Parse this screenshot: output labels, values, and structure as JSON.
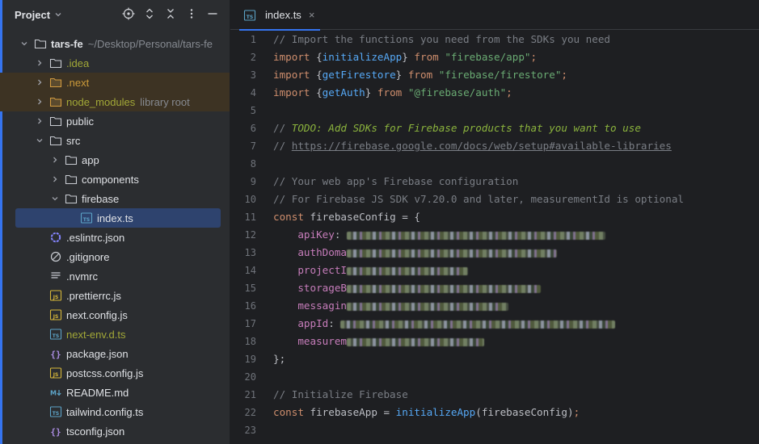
{
  "panel": {
    "title": "Project",
    "icons": [
      "locate-icon",
      "expand-collapse-icon",
      "collapse-all-icon",
      "more-options-icon",
      "minimize-icon"
    ]
  },
  "tree": [
    {
      "label": "tars-fe",
      "hint": "~/Desktop/Personal/tars-fe",
      "depth": 0,
      "chev": "down",
      "icon": "folder",
      "style": "bold"
    },
    {
      "label": ".idea",
      "depth": 1,
      "chev": "right",
      "icon": "folder",
      "style": "modified"
    },
    {
      "label": ".next",
      "depth": 1,
      "chev": "right",
      "icon": "folder-excluded",
      "style": "excluded",
      "ignored": true
    },
    {
      "label": "node_modules",
      "hint": "library root",
      "depth": 1,
      "chev": "right",
      "icon": "folder-excluded",
      "style": "modified",
      "ignored": true
    },
    {
      "label": "public",
      "depth": 1,
      "chev": "right",
      "icon": "folder",
      "style": ""
    },
    {
      "label": "src",
      "depth": 1,
      "chev": "down",
      "icon": "folder",
      "style": ""
    },
    {
      "label": "app",
      "depth": 2,
      "chev": "right",
      "icon": "folder",
      "style": ""
    },
    {
      "label": "components",
      "depth": 2,
      "chev": "right",
      "icon": "folder",
      "style": ""
    },
    {
      "label": "firebase",
      "depth": 2,
      "chev": "down",
      "icon": "folder",
      "style": ""
    },
    {
      "label": "index.ts",
      "depth": 3,
      "chev": "none",
      "icon": "ts",
      "style": "",
      "selected": true
    },
    {
      "label": ".eslintrc.json",
      "depth": 1,
      "chev": "none",
      "icon": "eslint",
      "style": ""
    },
    {
      "label": ".gitignore",
      "depth": 1,
      "chev": "none",
      "icon": "ignore",
      "style": ""
    },
    {
      "label": ".nvmrc",
      "depth": 1,
      "chev": "none",
      "icon": "text",
      "style": ""
    },
    {
      "label": ".prettierrc.js",
      "depth": 1,
      "chev": "none",
      "icon": "js",
      "style": ""
    },
    {
      "label": "next.config.js",
      "depth": 1,
      "chev": "none",
      "icon": "js",
      "style": ""
    },
    {
      "label": "next-env.d.ts",
      "depth": 1,
      "chev": "none",
      "icon": "ts",
      "style": "modified"
    },
    {
      "label": "package.json",
      "depth": 1,
      "chev": "none",
      "icon": "json",
      "style": ""
    },
    {
      "label": "postcss.config.js",
      "depth": 1,
      "chev": "none",
      "icon": "js",
      "style": ""
    },
    {
      "label": "README.md",
      "depth": 1,
      "chev": "none",
      "icon": "md",
      "style": ""
    },
    {
      "label": "tailwind.config.ts",
      "depth": 1,
      "chev": "none",
      "icon": "ts",
      "style": ""
    },
    {
      "label": "tsconfig.json",
      "depth": 1,
      "chev": "none",
      "icon": "json",
      "style": ""
    }
  ],
  "editor": {
    "tab": {
      "label": "index.ts",
      "close": "×"
    },
    "lines": [
      [
        [
          "cm",
          "// Import the functions you need from the SDKs you need"
        ]
      ],
      [
        [
          "kw",
          "import "
        ],
        [
          "ident",
          "{"
        ],
        [
          "fn",
          "initializeApp"
        ],
        [
          "ident",
          "} "
        ],
        [
          "kw",
          "from "
        ],
        [
          "str",
          "\"firebase/app\""
        ],
        [
          "kw",
          ";"
        ]
      ],
      [
        [
          "kw",
          "import "
        ],
        [
          "ident",
          "{"
        ],
        [
          "fn",
          "getFirestore"
        ],
        [
          "ident",
          "} "
        ],
        [
          "kw",
          "from "
        ],
        [
          "str",
          "\"firebase/firestore\""
        ],
        [
          "kw",
          ";"
        ]
      ],
      [
        [
          "kw",
          "import "
        ],
        [
          "ident",
          "{"
        ],
        [
          "fn",
          "getAuth"
        ],
        [
          "ident",
          "} "
        ],
        [
          "kw",
          "from "
        ],
        [
          "str",
          "\"@firebase/auth\""
        ],
        [
          "kw",
          ";"
        ]
      ],
      [],
      [
        [
          "cm",
          "// "
        ],
        [
          "todo",
          "TODO: Add SDKs for Firebase products that you want to use"
        ]
      ],
      [
        [
          "cm",
          "// "
        ],
        [
          "url",
          "https://firebase.google.com/docs/web/setup#available-libraries"
        ]
      ],
      [],
      [
        [
          "cm",
          "// Your web app's Firebase configuration"
        ]
      ],
      [
        [
          "cm",
          "// For Firebase JS SDK v7.20.0 and later, measurementId is optional"
        ]
      ],
      [
        [
          "kw",
          "const "
        ],
        [
          "ident",
          "firebaseConfig = {"
        ]
      ],
      [
        [
          "ident",
          "    "
        ],
        [
          "prop",
          "apiKey"
        ],
        [
          "ident",
          ": "
        ],
        [
          "blur",
          "320"
        ]
      ],
      [
        [
          "ident",
          "    "
        ],
        [
          "prop",
          "authDoma"
        ],
        [
          "blur",
          "260"
        ]
      ],
      [
        [
          "ident",
          "    "
        ],
        [
          "prop",
          "projectI"
        ],
        [
          "blur",
          "150"
        ]
      ],
      [
        [
          "ident",
          "    "
        ],
        [
          "prop",
          "storageB"
        ],
        [
          "blur",
          "240"
        ]
      ],
      [
        [
          "ident",
          "    "
        ],
        [
          "prop",
          "messagin"
        ],
        [
          "blur",
          "200"
        ]
      ],
      [
        [
          "ident",
          "    "
        ],
        [
          "prop",
          "appId"
        ],
        [
          "ident",
          ": "
        ],
        [
          "blur",
          "340"
        ]
      ],
      [
        [
          "ident",
          "    "
        ],
        [
          "prop",
          "measurem"
        ],
        [
          "blur",
          "170"
        ]
      ],
      [
        [
          "ident",
          "};"
        ]
      ],
      [],
      [
        [
          "cm",
          "// Initialize Firebase"
        ]
      ],
      [
        [
          "kw",
          "const "
        ],
        [
          "ident",
          "firebaseApp = "
        ],
        [
          "fn",
          "initializeApp"
        ],
        [
          "ident",
          "(firebaseConfig)"
        ],
        [
          "kw",
          ";"
        ]
      ],
      []
    ],
    "line_numbers": [
      "1",
      "2",
      "3",
      "4",
      "5",
      "6",
      "7",
      "8",
      "9",
      "10",
      "11",
      "12",
      "13",
      "14",
      "15",
      "16",
      "17",
      "18",
      "19",
      "20",
      "21",
      "22",
      "23"
    ]
  },
  "colors": {
    "accent": "#3574f0",
    "keyword": "#cf8e6d",
    "function": "#56a8f5",
    "string": "#6aab73",
    "comment": "#7a7e85",
    "property": "#c77dbb"
  }
}
